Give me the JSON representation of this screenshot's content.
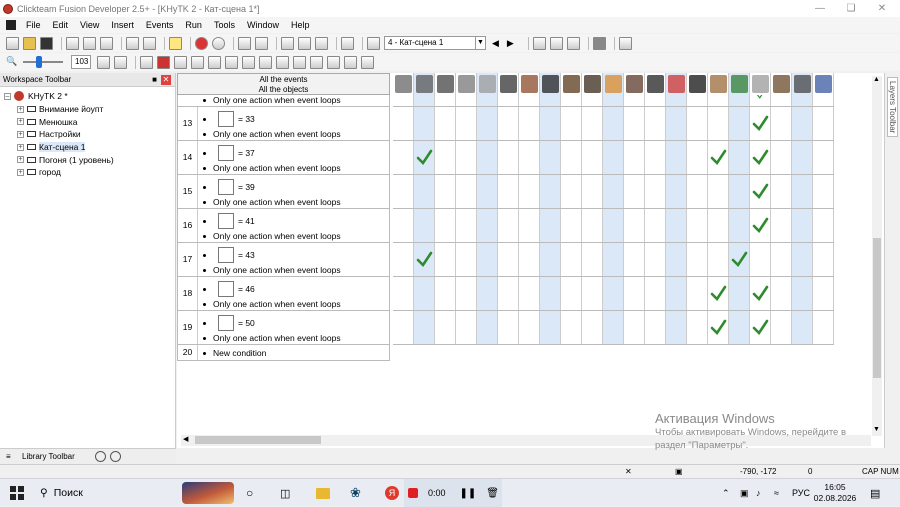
{
  "window": {
    "title": "Clickteam Fusion Developer 2.5+ - [KHyTK 2  - Кат-сцена 1*]"
  },
  "menu": [
    "File",
    "Edit",
    "View",
    "Insert",
    "Events",
    "Run",
    "Tools",
    "Window",
    "Help"
  ],
  "toolbar": {
    "frame_combo": "4 - Кат-сцена 1",
    "zoom_value": "103"
  },
  "workspace": {
    "title": "Workspace Toolbar",
    "root": "KHyTK 2 *",
    "frames": [
      "Внимание йоупт",
      "Менюшка",
      "Настройки",
      "Кат-сцена 1",
      "Погоня (1 уровень)",
      "город"
    ]
  },
  "library": {
    "title": "Library Toolbar"
  },
  "event_header": {
    "line1": "All the events",
    "line2": "All the objects"
  },
  "top_partial": "Only one action when event loops",
  "events": [
    {
      "num": "13",
      "value": "= 33",
      "note": "Only one action when event loops",
      "checks": [
        17
      ]
    },
    {
      "num": "14",
      "value": "= 37",
      "note": "Only one action when event loops",
      "checks": [
        1,
        15,
        17
      ]
    },
    {
      "num": "15",
      "value": "= 39",
      "note": "Only one action when event loops",
      "checks": [
        17
      ]
    },
    {
      "num": "16",
      "value": "= 41",
      "note": "Only one action when event loops",
      "checks": [
        17
      ]
    },
    {
      "num": "17",
      "value": "= 43",
      "note": "Only one action when event loops",
      "checks": [
        1,
        16
      ]
    },
    {
      "num": "18",
      "value": "= 46",
      "note": "Only one action when event loops",
      "checks": [
        15,
        17
      ]
    },
    {
      "num": "19",
      "value": "= 50",
      "note": "Only one action when event loops",
      "checks": [
        15,
        17
      ]
    }
  ],
  "new_condition": {
    "num": "20",
    "label": "New condition"
  },
  "layers_toolbar": "Layers Toolbar",
  "status": {
    "coords": "-790, -172",
    "zero": "0",
    "caps": "CAP NUM"
  },
  "watermark": {
    "line1": "Активация Windows",
    "line2": "Чтобы активировать Windows, перейдите в",
    "line3": "раздел \"Параметры\"."
  },
  "taskbar": {
    "search": "Поиск",
    "timer": "0:00",
    "lang": "РУС",
    "time": "16:05",
    "date": "02.08.2026"
  },
  "colors": {
    "check": "#2e8b2e",
    "accent_blue": "#dbe8f7",
    "row_line": "#cccccc"
  }
}
